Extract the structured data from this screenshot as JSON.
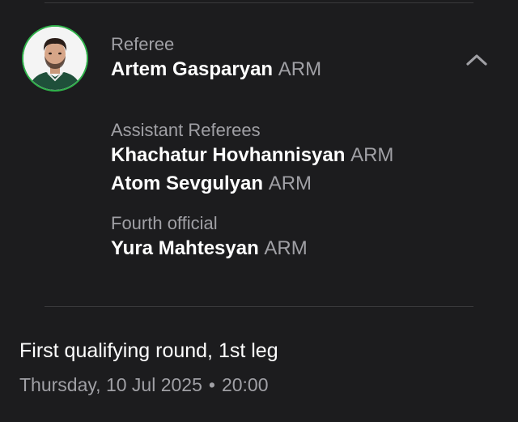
{
  "referee": {
    "label": "Referee",
    "name": "Artem Gasparyan",
    "country": "ARM",
    "avatar_icon": "person-photo-icon",
    "avatar_ring_color": "#2fb14a"
  },
  "assistants": {
    "label": "Assistant Referees",
    "items": [
      {
        "name": "Khachatur Hovhannisyan",
        "country": "ARM"
      },
      {
        "name": "Atom Sevgulyan",
        "country": "ARM"
      }
    ]
  },
  "fourth_official": {
    "label": "Fourth official",
    "name": "Yura Mahtesyan",
    "country": "ARM"
  },
  "collapse_icon": "chevron-up-icon",
  "match": {
    "round": "First qualifying round, 1st leg",
    "date": "Thursday, 10 Jul 2025",
    "separator": "•",
    "time": "20:00"
  }
}
